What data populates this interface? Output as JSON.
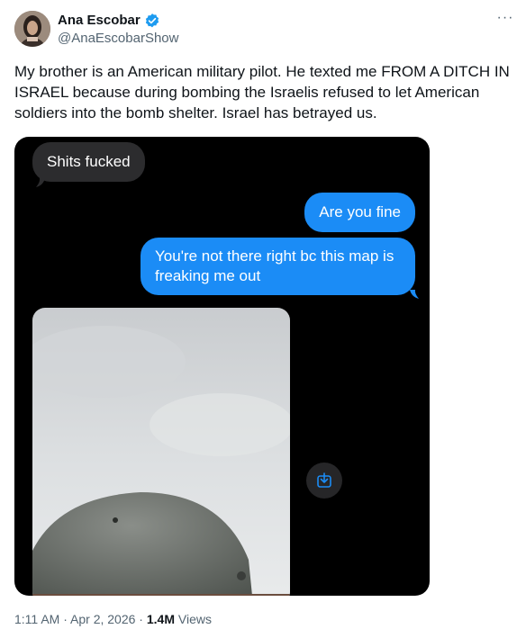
{
  "author": {
    "name": "Ana Escobar",
    "handle": "@AnaEscobarShow"
  },
  "more_label": "···",
  "tweet": {
    "text": "My brother is an American military pilot. He texted me FROM A DITCH IN ISRAEL because during bombing the Israelis refused to let American soldiers into the bomb shelter. Israel has betrayed us."
  },
  "messages": [
    {
      "direction": "incoming",
      "text": "Shits fucked"
    },
    {
      "direction": "outgoing",
      "text": "Are you fine"
    },
    {
      "direction": "outgoing",
      "text": "You're not there right bc this map is freaking me out"
    }
  ],
  "meta": {
    "time": "1:11 AM",
    "date": "Apr 2, 2026",
    "views_count": "1.4M",
    "views_label": "Views",
    "separator": "·"
  },
  "colors": {
    "verified": "#1d9bf0",
    "outgoing_bubble": "#1b8cf6",
    "incoming_bubble": "#2c2c2e",
    "media_bg": "#000000"
  },
  "icons": {
    "verified": "verified-badge-icon",
    "more": "more-options-icon",
    "save": "save-download-icon"
  }
}
